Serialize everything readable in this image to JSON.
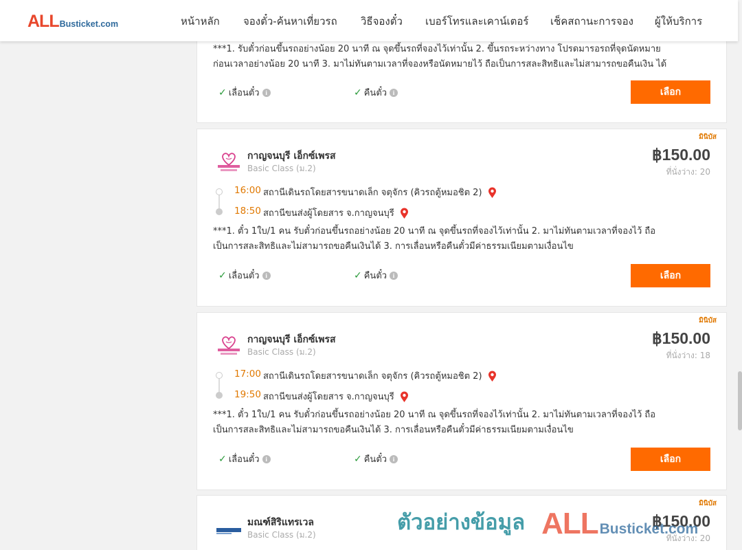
{
  "header": {
    "logo_main": "ALL",
    "logo_rest": "Busticket.com",
    "nav": [
      "หน้าหลัก",
      "จองตั๋ว-ค้นหาเที่ยวรถ",
      "วิธีจองตั๋ว",
      "เบอร์โทรและเคาน์เตอร์",
      "เช็คสถานะการจอง",
      "ผู้ให้บริการ"
    ]
  },
  "top_card": {
    "note_lines": [
      "***1. รับตั๋วก่อนขึ้นรถอย่างน้อย 20 นาที ณ จุดขึ้นรถที่จองไว้เท่านั้น 2. ขึ้นรถระหว่างทาง โปรดมารอรถที่จุดนัดหมาย",
      "ก่อนเวลาอย่างน้อย 20 นาที 3. มาไม่ทันตามเวลาที่จองหรือนัดหมายไว้ ถือเป็นการสละสิทธิและไม่สามารถขอคืนเงิน ได้"
    ],
    "reschedule": "เลื่อนตั๋ว",
    "refund": "คืนตั๋ว",
    "select": "เลือก"
  },
  "cards": [
    {
      "badge": "มินิบัส",
      "operator": "กาญจนบุรี เอ็กซ์เพรส",
      "class": "Basic Class (ม.2)",
      "price": "฿150.00",
      "seats": "ที่นั่งว่าง: 20",
      "depart_time": "16:00",
      "depart_station": "สถานีเดินรถโดยสารขนาดเล็ก จตุจักร (คิวรถตู้หมอชิต 2)",
      "arrive_time": "18:50",
      "arrive_station": "สถานีขนส่งผู้โดยสาร จ.กาญจนบุรี",
      "note_lines": [
        "***1. ตั๋ว 1ใบ/1 คน รับตั๋วก่อนขึ้นรถอย่างน้อย 20 นาที ณ จุดขึ้นรถที่จองไว้เท่านั้น 2. มาไม่ทันตามเวลาที่จองไว้ ถือ",
        "เป็นการสละสิทธิและไม่สามารถขอคืนเงินได้ 3. การเลื่อนหรือคืนตั๋วมีค่าธรรมเนียมตามเงื่อนไข"
      ],
      "reschedule": "เลื่อนตั๋ว",
      "refund": "คืนตั๋ว",
      "select": "เลือก"
    },
    {
      "badge": "มินิบัส",
      "operator": "กาญจนบุรี เอ็กซ์เพรส",
      "class": "Basic Class (ม.2)",
      "price": "฿150.00",
      "seats": "ที่นั่งว่าง: 18",
      "depart_time": "17:00",
      "depart_station": "สถานีเดินรถโดยสารขนาดเล็ก จตุจักร (คิวรถตู้หมอชิต 2)",
      "arrive_time": "19:50",
      "arrive_station": "สถานีขนส่งผู้โดยสาร จ.กาญจนบุรี",
      "note_lines": [
        "***1. ตั๋ว 1ใบ/1 คน รับตั๋วก่อนขึ้นรถอย่างน้อย 20 นาที ณ จุดขึ้นรถที่จองไว้เท่านั้น 2. มาไม่ทันตามเวลาที่จองไว้ ถือ",
        "เป็นการสละสิทธิและไม่สามารถขอคืนเงินได้ 3. การเลื่อนหรือคืนตั๋วมีค่าธรรมเนียมตามเงื่อนไข"
      ],
      "reschedule": "เลื่อนตั๋ว",
      "refund": "คืนตั๋ว",
      "select": "เลือก"
    },
    {
      "badge": "มินิบัส",
      "operator": "มณฑ์สิริแทรเวล",
      "class": "Basic Class (ม.2)",
      "price": "฿150.00",
      "seats": "ที่นั่งว่าง: 20"
    }
  ],
  "watermark": {
    "text": "ตัวอย่างข้อมูล",
    "logo_main": "ALL",
    "logo_rest": "Busticket.com"
  },
  "colors": {
    "accent_orange": "#ff6a00",
    "time_orange": "#e07800",
    "check_green": "#2a9a3a",
    "pin_red": "#e8332a"
  }
}
